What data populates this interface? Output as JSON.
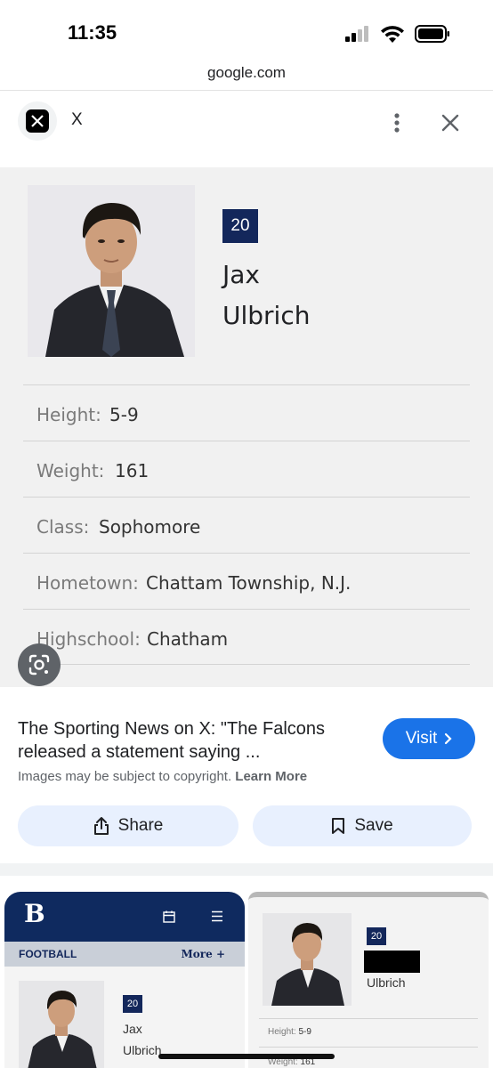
{
  "status": {
    "time": "11:35"
  },
  "browser": {
    "url": "google.com"
  },
  "source": {
    "name": "X"
  },
  "profile": {
    "number": "20",
    "first_name": "Jax",
    "last_name": "Ulbrich",
    "rows": [
      {
        "label": "Height:",
        "value": "5-9"
      },
      {
        "label": "Weight:",
        "value": "161"
      },
      {
        "label": "Class:",
        "value": "Sophomore"
      },
      {
        "label": "Hometown:",
        "value": "Chattam Township, N.J."
      },
      {
        "label": "Highschool:",
        "value": "Chatham"
      }
    ]
  },
  "result": {
    "title": "The Sporting News on X: \"The Falcons released a statement saying ...",
    "copyright_text": "Images may be subject to copyright.",
    "learn_more": "Learn More",
    "visit_label": "Visit",
    "share_label": "Share",
    "save_label": "Save"
  },
  "related_left": {
    "logo": "B",
    "nav_label": "FOOTBALL",
    "more_label": "More +",
    "number": "20",
    "first_name": "Jax",
    "last_name": "Ulbrich"
  },
  "related_right": {
    "number": "20",
    "last_name": "Ulbrich",
    "height_label": "Height:",
    "height_value": "5-9",
    "weight_label": "Weight:",
    "weight_value": "161"
  },
  "colors": {
    "accent": "#1a73e8",
    "navy": "#13275b",
    "pill_bg": "#e8f0fe"
  },
  "icons": [
    "signal-icon",
    "wifi-icon",
    "battery-icon",
    "x-logo-icon",
    "more-vert-icon",
    "close-icon",
    "google-lens-icon",
    "chevron-right-icon",
    "share-icon",
    "bookmark-icon",
    "calendar-icon",
    "menu-icon"
  ]
}
